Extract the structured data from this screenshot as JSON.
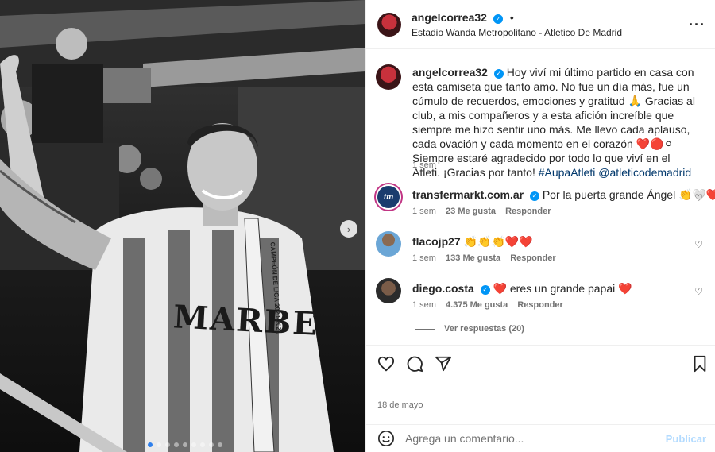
{
  "post": {
    "author": "angelcorrea32",
    "location": "Estadio Wanda Metropolitano - Atletico De Madrid",
    "header_separator": "•",
    "more_icon": "more-horizontal-icon",
    "caption": {
      "username": "angelcorrea32",
      "text": "Hoy viví mi último partido en casa con esta camiseta que tanto amo. No fue un día más, fue un cúmulo de recuerdos, emociones y gratitud 🙏 Gracias al club, a mis compañeros y a esta afición increíble que siempre me hizo sentir uno más. Me llevo cada aplauso, cada ovación y cada momento en el corazón ❤️🔴⚪ Siempre estaré agradecido por todo lo que viví en el Atleti. ¡Gracias por tanto!",
      "hashtag": "#AupaAtleti",
      "mention": "@atleticodemadrid",
      "time": "1 sem"
    },
    "photo": {
      "shirt_text": "MARBE",
      "scarf_text": "CAMPEÓN DE LIGA 2020-2021",
      "carousel_total": 9,
      "carousel_active": 1
    }
  },
  "comments": [
    {
      "username": "transfermarkt.com.ar",
      "verified": true,
      "avatar_text": "tm",
      "text": "Por la puerta grande Ángel 👏🤍❤️",
      "time": "1 sem",
      "likes": "23 Me gusta",
      "reply": "Responder"
    },
    {
      "username": "flacojp27",
      "verified": false,
      "text": "👏👏👏❤️❤️",
      "time": "1 sem",
      "likes": "133 Me gusta",
      "reply": "Responder"
    },
    {
      "username": "diego.costa",
      "verified": true,
      "text": "❤️ eres un grande papai ❤️",
      "time": "1 sem",
      "likes": "4.375 Me gusta",
      "reply": "Responder"
    }
  ],
  "view_replies": "Ver respuestas (20)",
  "date": "18 de mayo",
  "composer": {
    "placeholder": "Agrega un comentario...",
    "publish": "Publicar"
  },
  "colors": {
    "accent": "#0095f6",
    "publish_disabled": "#b3dbff",
    "link": "#00376b",
    "secondary_text": "#737373"
  }
}
